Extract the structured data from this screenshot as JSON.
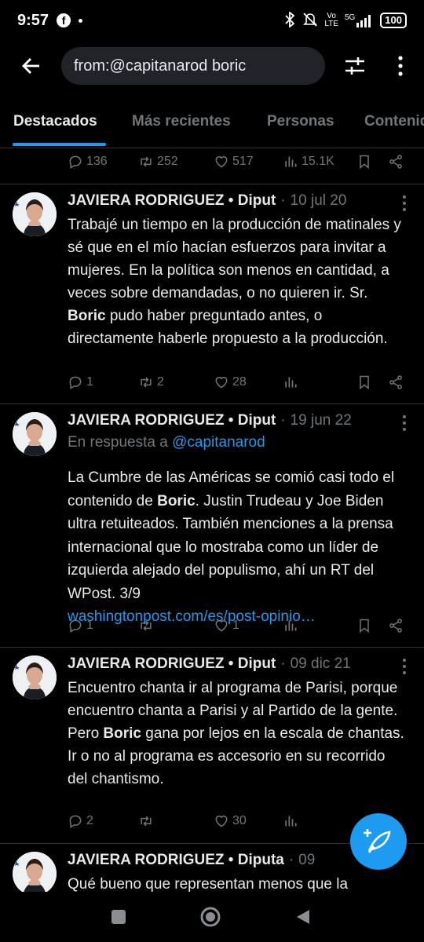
{
  "status_bar": {
    "time": "9:57",
    "network": "5G",
    "battery": "100"
  },
  "search": {
    "query": "from:@capitanarod boric"
  },
  "tabs": [
    {
      "label": "Destacados"
    },
    {
      "label": "Más recientes"
    },
    {
      "label": "Personas"
    },
    {
      "label": "Contenido"
    }
  ],
  "top_actions": {
    "replies": "136",
    "retweets": "252",
    "likes": "517",
    "views": "15.1K"
  },
  "tweets": [
    {
      "author": "JAVIERA RODRIGUEZ • Diput",
      "date": "10 jul 20",
      "text_1": "Trabajé un tiempo en la producción de matinales y sé que en el mío hacían esfuerzos para invitar a mujeres. En la política son menos en cantidad, a veces sobre demandadas, o no quieren ir. Sr. ",
      "highlight": "Boric",
      "text_2": " pudo haber preguntado antes, o directamente haberle propuesto a la producción.",
      "replies": "1",
      "retweets": "2",
      "likes": "28"
    },
    {
      "author": "JAVIERA RODRIGUEZ • Diput",
      "date": "19 jun 22",
      "reply_prefix": "En respuesta a ",
      "reply_to": "@capitanarod",
      "text_1": "La Cumbre de las Américas se comió  casi todo el contenido de ",
      "highlight": "Boric",
      "text_2": ". Justin Trudeau y Joe Biden ultra retuiteados. También menciones a la prensa internacional que lo mostraba como un líder de izquierda alejado del populismo, ahí un RT del WPost. 3/9",
      "link": "washingtonpost.com/es/post-opinio…",
      "replies": "1",
      "retweets": "",
      "likes": "1"
    },
    {
      "author": "JAVIERA RODRIGUEZ • Diput",
      "date": "09 dic 21",
      "text_1": "Encuentro chanta ir al programa de Parisi, porque encuentro chanta a Parisi y al Partido de la gente.\nPero ",
      "highlight": "Boric",
      "text_2": " gana por lejos en la escala de chantas. Ir o no al programa es accesorio en su recorrido del chantismo.",
      "replies": "2",
      "retweets": "",
      "likes": "30"
    },
    {
      "author": "JAVIERA RODRIGUEZ • Diputa",
      "date": "09",
      "text_1": "Qué bueno que representan menos que la"
    }
  ]
}
